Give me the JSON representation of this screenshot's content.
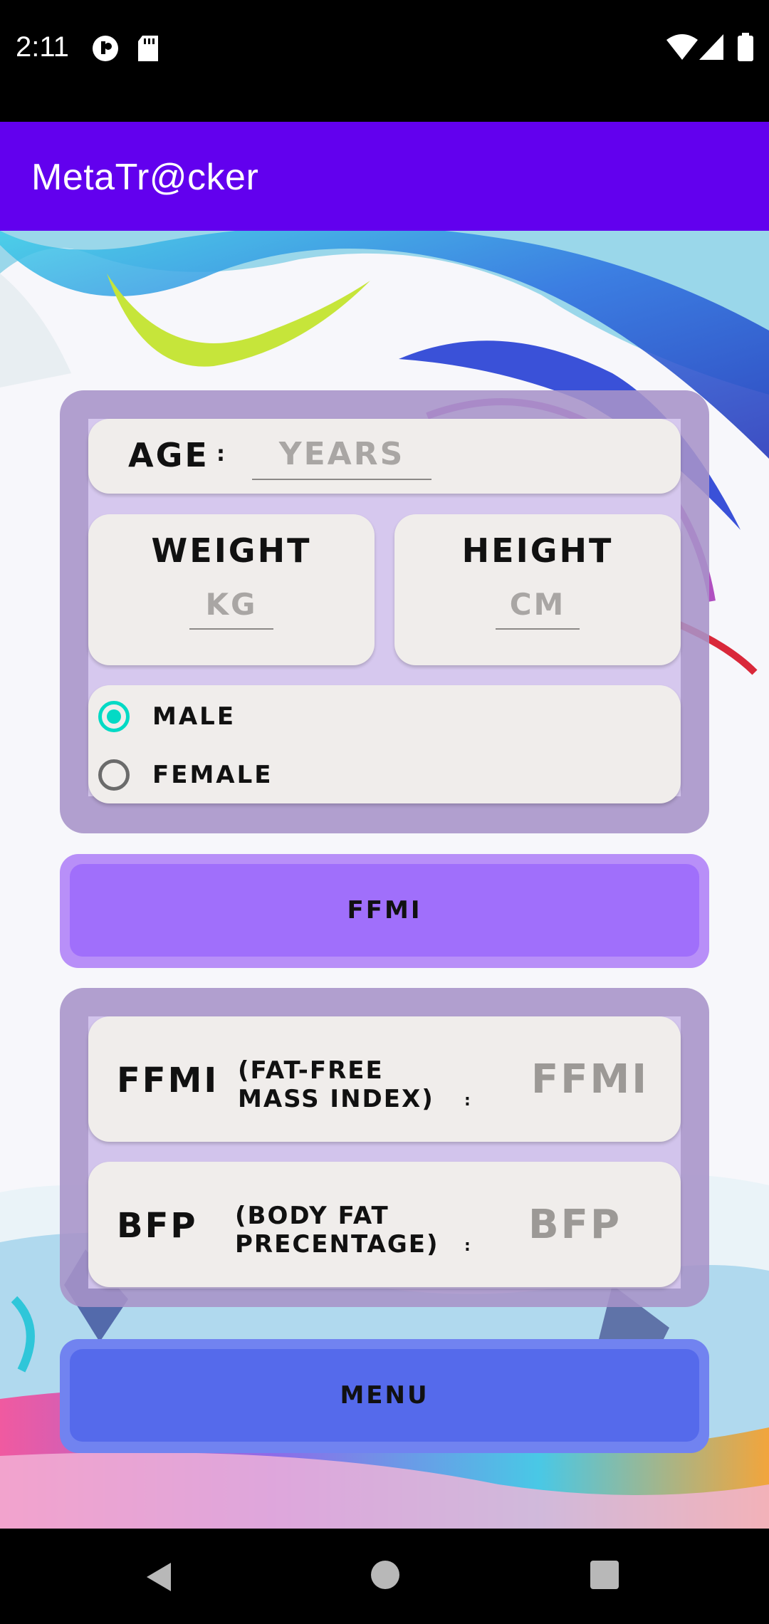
{
  "status_bar": {
    "time": "2:11",
    "icons": [
      "privacy-dot-icon",
      "sd-card-icon",
      "wifi-icon",
      "signal-icon",
      "battery-icon"
    ]
  },
  "app_bar": {
    "title": "MetaTr@cker",
    "color": "#6200ee"
  },
  "form": {
    "age": {
      "label": "AGE",
      "separator": ":",
      "placeholder": "YEARS"
    },
    "weight": {
      "label": "WEIGHT",
      "placeholder": "KG"
    },
    "height": {
      "label": "HEIGHT",
      "placeholder": "CM"
    },
    "gender": {
      "options": [
        {
          "label": "MALE",
          "selected": true
        },
        {
          "label": "FEMALE",
          "selected": false
        }
      ],
      "accent": "#03dac5"
    }
  },
  "calculate_button": {
    "label": "FFMI",
    "color": "#a06ffb"
  },
  "results": {
    "ffmi": {
      "abbr": "FFMI",
      "desc_line1": "(FAT-FREE",
      "desc_line2": "MASS INDEX)",
      "separator": ":",
      "value": "FFMI"
    },
    "bfp": {
      "abbr": "BFP",
      "desc_line1": "(BODY FAT",
      "desc_line2": "PRECENTAGE)",
      "separator": ":",
      "value": "BFP"
    }
  },
  "menu_button": {
    "label": "MENU",
    "color": "#556aeb"
  },
  "nav_bar": {
    "icons": [
      "back-icon",
      "home-icon",
      "recents-icon"
    ]
  }
}
